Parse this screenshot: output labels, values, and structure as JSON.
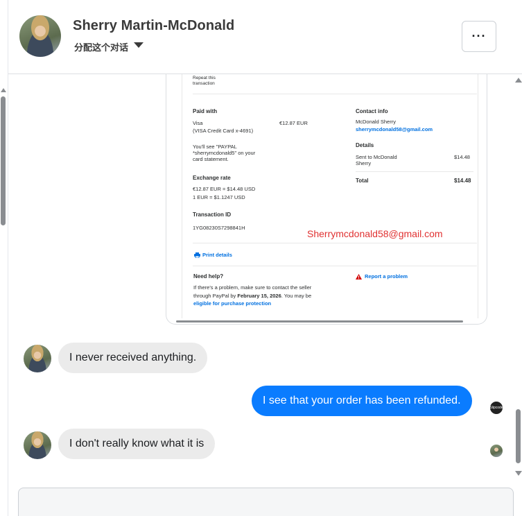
{
  "header": {
    "contact_name": "Sherry Martin-McDonald",
    "assign_label": "分配这个对话",
    "more_label": "···"
  },
  "receipt": {
    "repeat_label": "Repeat this transaction",
    "paid_with_heading": "Paid with",
    "visa_text": "Visa",
    "card_line": "(VISA Credit Card x-4691)",
    "statement_line": "You'll see \"PAYPAL *sherrymcdonald5\" on your card statement.",
    "amount_paid": "€12.87 EUR",
    "contact_heading": "Contact info",
    "contact_name": "McDonald Sherry",
    "contact_email": "sherrymcdonald58@gmail.com",
    "details_heading": "Details",
    "sent_to_label": "Sent to McDonald Sherry",
    "sent_to_amount": "$14.48",
    "total_label": "Total",
    "total_amount": "$14.48",
    "exchange_heading": "Exchange rate",
    "exchange_line1": "€12.87 EUR = $14.48 USD",
    "exchange_line2": "1 EUR = $1.1247 USD",
    "txn_heading": "Transaction ID",
    "txn_id": "1YG08230S7298841H",
    "email_overlay": "Sherrymcdonald58@gmail.com",
    "print_label": "Print details",
    "help_heading": "Need help?",
    "help_text_1": "If there's a problem, make sure to contact the seller through PayPal by ",
    "help_date": "February 15, 2026",
    "help_text_2": ". You may be ",
    "help_link": "eligible for purchase protection",
    "report_label": "Report a problem"
  },
  "messages": [
    {
      "from": "contact",
      "text": "I never received anything."
    },
    {
      "from": "me",
      "text": "I see that your order has been refunded."
    },
    {
      "from": "contact",
      "text": "I don't really know what it is"
    }
  ],
  "read_receipt_label": "Slipcode",
  "colors": {
    "outgoing_bubble": "#0a7cff",
    "incoming_bubble": "#ebebeb",
    "paypal_link": "#0070e0",
    "overlay_red": "#e03131"
  }
}
